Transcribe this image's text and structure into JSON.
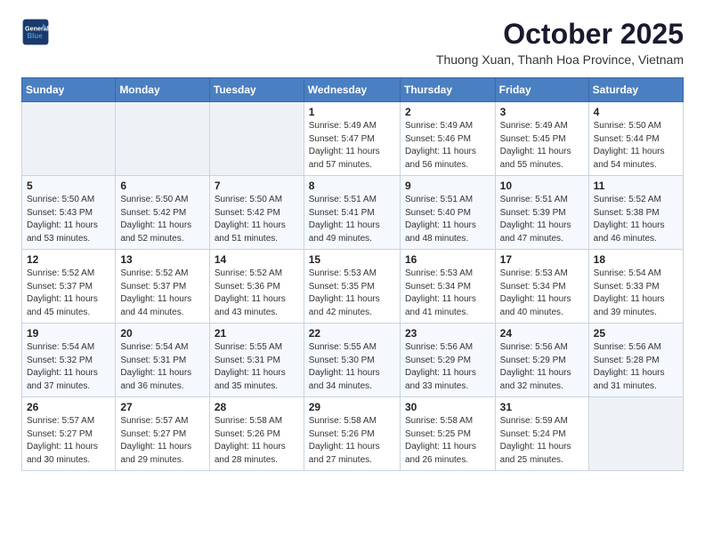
{
  "logo": {
    "line1": "General",
    "line2": "Blue"
  },
  "title": "October 2025",
  "location": "Thuong Xuan, Thanh Hoa Province, Vietnam",
  "weekdays": [
    "Sunday",
    "Monday",
    "Tuesday",
    "Wednesday",
    "Thursday",
    "Friday",
    "Saturday"
  ],
  "weeks": [
    [
      {
        "day": "",
        "info": ""
      },
      {
        "day": "",
        "info": ""
      },
      {
        "day": "",
        "info": ""
      },
      {
        "day": "1",
        "info": "Sunrise: 5:49 AM\nSunset: 5:47 PM\nDaylight: 11 hours\nand 57 minutes."
      },
      {
        "day": "2",
        "info": "Sunrise: 5:49 AM\nSunset: 5:46 PM\nDaylight: 11 hours\nand 56 minutes."
      },
      {
        "day": "3",
        "info": "Sunrise: 5:49 AM\nSunset: 5:45 PM\nDaylight: 11 hours\nand 55 minutes."
      },
      {
        "day": "4",
        "info": "Sunrise: 5:50 AM\nSunset: 5:44 PM\nDaylight: 11 hours\nand 54 minutes."
      }
    ],
    [
      {
        "day": "5",
        "info": "Sunrise: 5:50 AM\nSunset: 5:43 PM\nDaylight: 11 hours\nand 53 minutes."
      },
      {
        "day": "6",
        "info": "Sunrise: 5:50 AM\nSunset: 5:42 PM\nDaylight: 11 hours\nand 52 minutes."
      },
      {
        "day": "7",
        "info": "Sunrise: 5:50 AM\nSunset: 5:42 PM\nDaylight: 11 hours\nand 51 minutes."
      },
      {
        "day": "8",
        "info": "Sunrise: 5:51 AM\nSunset: 5:41 PM\nDaylight: 11 hours\nand 49 minutes."
      },
      {
        "day": "9",
        "info": "Sunrise: 5:51 AM\nSunset: 5:40 PM\nDaylight: 11 hours\nand 48 minutes."
      },
      {
        "day": "10",
        "info": "Sunrise: 5:51 AM\nSunset: 5:39 PM\nDaylight: 11 hours\nand 47 minutes."
      },
      {
        "day": "11",
        "info": "Sunrise: 5:52 AM\nSunset: 5:38 PM\nDaylight: 11 hours\nand 46 minutes."
      }
    ],
    [
      {
        "day": "12",
        "info": "Sunrise: 5:52 AM\nSunset: 5:37 PM\nDaylight: 11 hours\nand 45 minutes."
      },
      {
        "day": "13",
        "info": "Sunrise: 5:52 AM\nSunset: 5:37 PM\nDaylight: 11 hours\nand 44 minutes."
      },
      {
        "day": "14",
        "info": "Sunrise: 5:52 AM\nSunset: 5:36 PM\nDaylight: 11 hours\nand 43 minutes."
      },
      {
        "day": "15",
        "info": "Sunrise: 5:53 AM\nSunset: 5:35 PM\nDaylight: 11 hours\nand 42 minutes."
      },
      {
        "day": "16",
        "info": "Sunrise: 5:53 AM\nSunset: 5:34 PM\nDaylight: 11 hours\nand 41 minutes."
      },
      {
        "day": "17",
        "info": "Sunrise: 5:53 AM\nSunset: 5:34 PM\nDaylight: 11 hours\nand 40 minutes."
      },
      {
        "day": "18",
        "info": "Sunrise: 5:54 AM\nSunset: 5:33 PM\nDaylight: 11 hours\nand 39 minutes."
      }
    ],
    [
      {
        "day": "19",
        "info": "Sunrise: 5:54 AM\nSunset: 5:32 PM\nDaylight: 11 hours\nand 37 minutes."
      },
      {
        "day": "20",
        "info": "Sunrise: 5:54 AM\nSunset: 5:31 PM\nDaylight: 11 hours\nand 36 minutes."
      },
      {
        "day": "21",
        "info": "Sunrise: 5:55 AM\nSunset: 5:31 PM\nDaylight: 11 hours\nand 35 minutes."
      },
      {
        "day": "22",
        "info": "Sunrise: 5:55 AM\nSunset: 5:30 PM\nDaylight: 11 hours\nand 34 minutes."
      },
      {
        "day": "23",
        "info": "Sunrise: 5:56 AM\nSunset: 5:29 PM\nDaylight: 11 hours\nand 33 minutes."
      },
      {
        "day": "24",
        "info": "Sunrise: 5:56 AM\nSunset: 5:29 PM\nDaylight: 11 hours\nand 32 minutes."
      },
      {
        "day": "25",
        "info": "Sunrise: 5:56 AM\nSunset: 5:28 PM\nDaylight: 11 hours\nand 31 minutes."
      }
    ],
    [
      {
        "day": "26",
        "info": "Sunrise: 5:57 AM\nSunset: 5:27 PM\nDaylight: 11 hours\nand 30 minutes."
      },
      {
        "day": "27",
        "info": "Sunrise: 5:57 AM\nSunset: 5:27 PM\nDaylight: 11 hours\nand 29 minutes."
      },
      {
        "day": "28",
        "info": "Sunrise: 5:58 AM\nSunset: 5:26 PM\nDaylight: 11 hours\nand 28 minutes."
      },
      {
        "day": "29",
        "info": "Sunrise: 5:58 AM\nSunset: 5:26 PM\nDaylight: 11 hours\nand 27 minutes."
      },
      {
        "day": "30",
        "info": "Sunrise: 5:58 AM\nSunset: 5:25 PM\nDaylight: 11 hours\nand 26 minutes."
      },
      {
        "day": "31",
        "info": "Sunrise: 5:59 AM\nSunset: 5:24 PM\nDaylight: 11 hours\nand 25 minutes."
      },
      {
        "day": "",
        "info": ""
      }
    ]
  ]
}
